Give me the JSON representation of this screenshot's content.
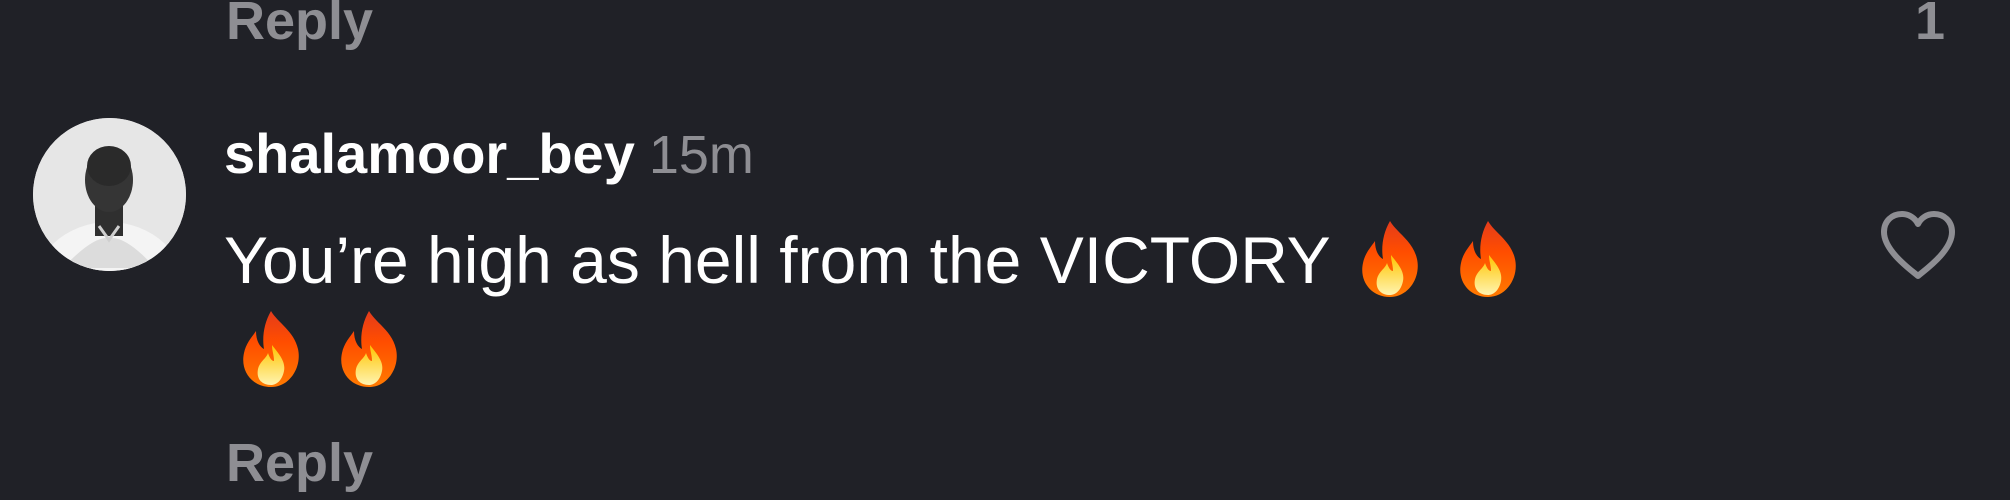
{
  "previous_comment": {
    "reply_label": "Reply",
    "like_count": "1"
  },
  "comment": {
    "username": "shalamoor_bey",
    "timestamp": "15m",
    "text": "You’re high as hell from the VICTORY",
    "emojis": [
      "🔥",
      "🔥",
      "🔥",
      "🔥"
    ],
    "reply_label": "Reply",
    "avatar_icon": "profile-photo",
    "like_icon": "heart-outline-icon"
  },
  "colors": {
    "background": "#202127",
    "primary_text": "#ffffff",
    "secondary_text": "#8e8e93"
  }
}
